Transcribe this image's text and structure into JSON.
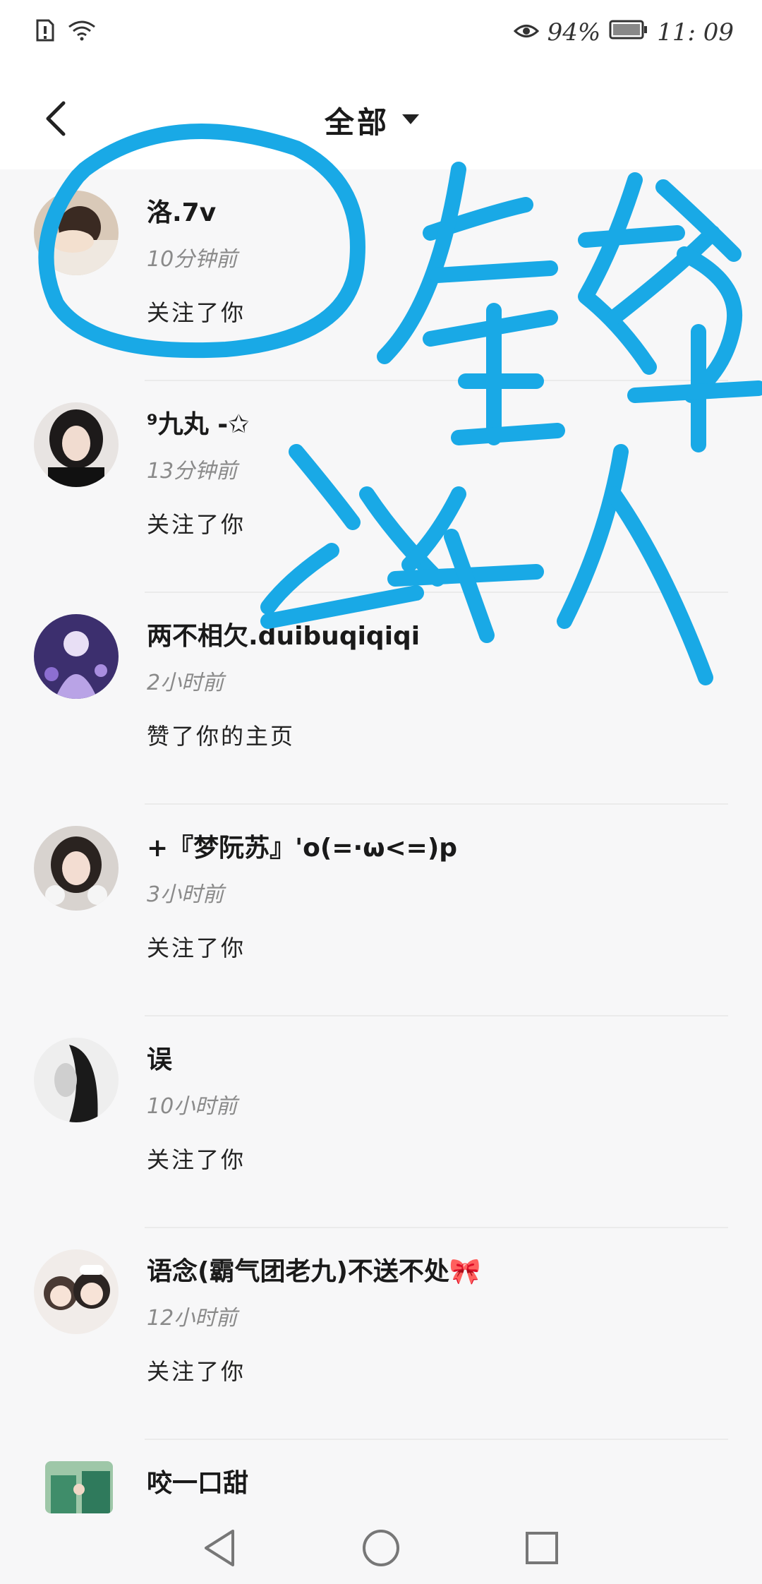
{
  "status_bar": {
    "battery_percent": "94%",
    "time": "11: 09"
  },
  "header": {
    "filter_label": "全部"
  },
  "notifications": [
    {
      "name": "洛.7v",
      "time": "10分钟前",
      "action": "关注了你"
    },
    {
      "name": "⁹九丸 -✩",
      "time": "13分钟前",
      "action": "关注了你"
    },
    {
      "name": "两不相欠.duibuqiqiqi",
      "time": "2小时前",
      "action": "赞了你的主页"
    },
    {
      "name": "+『梦阮苏』'o(=·ω<=)p",
      "time": "3小时前",
      "action": "关注了你"
    },
    {
      "name": "误",
      "time": "10小时前",
      "action": "关注了你"
    },
    {
      "name": "语念(霸气团老九)不送不处🎀",
      "time": "12小时前",
      "action": "关注了你"
    },
    {
      "name": "咬一口甜",
      "time": "",
      "action": ""
    }
  ],
  "colors": {
    "accent_scribble": "#19a9e6",
    "text_primary": "#1a1a1a",
    "text_secondary": "#8a8a8a"
  }
}
